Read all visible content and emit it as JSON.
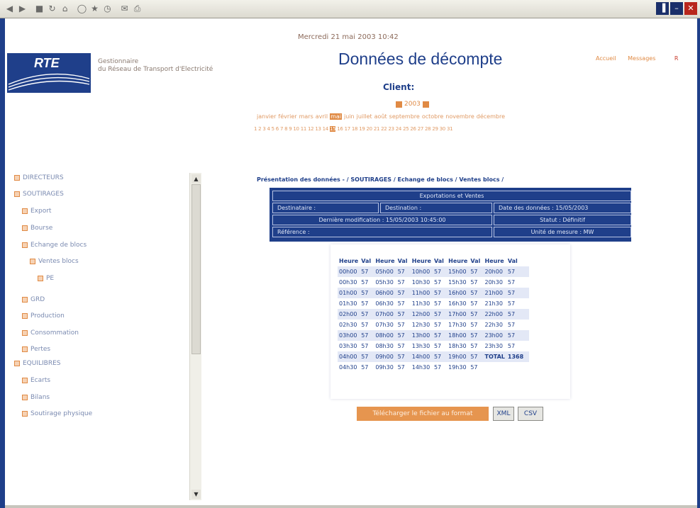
{
  "window": {
    "controls": [
      "▐",
      "–",
      "✕"
    ]
  },
  "header": {
    "date": "Mercredi 21 mai 2003 10:42",
    "logo_text": "RTE",
    "company_line1": "Gestionnaire",
    "company_line2": "du Réseau de Transport d'Electricité",
    "title": "Données de décompte",
    "links": [
      "Accueil",
      "Messages"
    ],
    "link_end": "R"
  },
  "client_label": "Client:",
  "year": "2003",
  "months": [
    "janvier",
    "février",
    "mars",
    "avril",
    "mai",
    "juin",
    "juillet",
    "août",
    "septembre",
    "octobre",
    "novembre",
    "décembre"
  ],
  "selected_month": "mai",
  "days": [
    "1",
    "2",
    "3",
    "4",
    "5",
    "6",
    "7",
    "8",
    "9",
    "10",
    "11",
    "12",
    "13",
    "14",
    "15",
    "16",
    "17",
    "18",
    "19",
    "20",
    "21",
    "22",
    "23",
    "24",
    "25",
    "26",
    "27",
    "28",
    "29",
    "30",
    "31"
  ],
  "selected_day": "15",
  "sidebar": {
    "items": [
      {
        "label": "DIRECTEURS",
        "level": 0
      },
      {
        "label": "SOUTIRAGES",
        "level": 0
      },
      {
        "label": "Export",
        "level": 1
      },
      {
        "label": "Bourse",
        "level": 1
      },
      {
        "label": "Echange de blocs",
        "level": 1
      },
      {
        "label": "Ventes blocs",
        "level": 2
      },
      {
        "label": "PE",
        "level": 3
      },
      {
        "label": "GRD",
        "level": 1
      },
      {
        "label": "Production",
        "level": 1
      },
      {
        "label": "Consommation",
        "level": 1
      },
      {
        "label": "Pertes",
        "level": 1
      },
      {
        "label": "EQUILIBRES",
        "level": 0
      },
      {
        "label": "Ecarts",
        "level": 1
      },
      {
        "label": "Bilans",
        "level": 1
      },
      {
        "label": "Soutirage physique",
        "level": 1
      }
    ]
  },
  "breadcrumb": "Présentation des données - / SOUTIRAGES / Echange de blocs / Ventes blocs /",
  "info_table": {
    "title": "Exportations et Ventes",
    "destinataire": "Destinataire :",
    "destination": "Destination :",
    "date_donnees": "Date des données : 15/05/2003",
    "derniere_modif": "Dernière modification : 15/05/2003 10:45:00",
    "statut": "Statut : Définitif",
    "reference": "Référence :",
    "unite": "Unité de mesure : MW"
  },
  "grid": {
    "headers": [
      "Heure",
      "Val",
      "Heure",
      "Val",
      "Heure",
      "Val",
      "Heure",
      "Val",
      "Heure",
      "Val"
    ],
    "rows": [
      [
        "00h00",
        "57",
        "05h00",
        "57",
        "10h00",
        "57",
        "15h00",
        "57",
        "20h00",
        "57"
      ],
      [
        "00h30",
        "57",
        "05h30",
        "57",
        "10h30",
        "57",
        "15h30",
        "57",
        "20h30",
        "57"
      ],
      [
        "01h00",
        "57",
        "06h00",
        "57",
        "11h00",
        "57",
        "16h00",
        "57",
        "21h00",
        "57"
      ],
      [
        "01h30",
        "57",
        "06h30",
        "57",
        "11h30",
        "57",
        "16h30",
        "57",
        "21h30",
        "57"
      ],
      [
        "02h00",
        "57",
        "07h00",
        "57",
        "12h00",
        "57",
        "17h00",
        "57",
        "22h00",
        "57"
      ],
      [
        "02h30",
        "57",
        "07h30",
        "57",
        "12h30",
        "57",
        "17h30",
        "57",
        "22h30",
        "57"
      ],
      [
        "03h00",
        "57",
        "08h00",
        "57",
        "13h00",
        "57",
        "18h00",
        "57",
        "23h00",
        "57"
      ],
      [
        "03h30",
        "57",
        "08h30",
        "57",
        "13h30",
        "57",
        "18h30",
        "57",
        "23h30",
        "57"
      ],
      [
        "04h00",
        "57",
        "09h00",
        "57",
        "14h00",
        "57",
        "19h00",
        "57",
        "TOTAL",
        "1368"
      ],
      [
        "04h30",
        "57",
        "09h30",
        "57",
        "14h30",
        "57",
        "19h30",
        "57",
        "",
        ""
      ]
    ]
  },
  "actions": {
    "download": "Télécharger le fichier au format",
    "xml": "XML",
    "csv": "CSV"
  },
  "colors": {
    "brand_blue": "#1f3f8a",
    "orange": "#e08a44"
  }
}
